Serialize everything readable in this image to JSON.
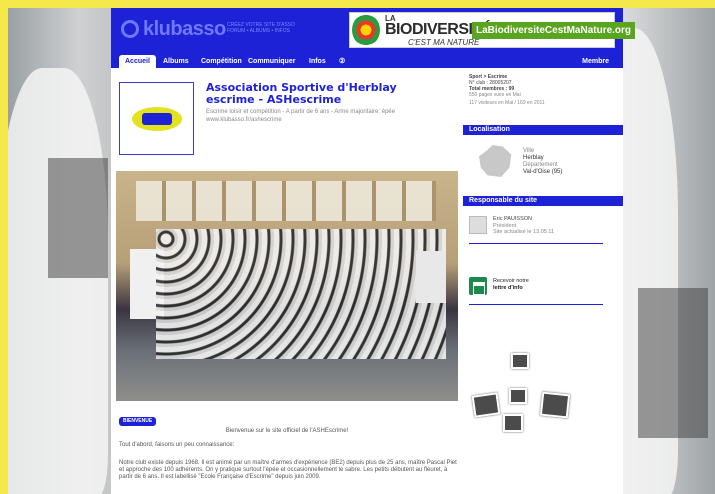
{
  "site": {
    "logo": "klubasso",
    "tagline": "CRÉEZ VOTRE SITE D'ASSO\nFORUM • ALBUMS • INFOS",
    "banner": {
      "line1": "LA",
      "line2": "BIODIVERSITÉ",
      "line3": "C'EST MA NATURE",
      "url": "LaBiodiversiteCestMaNature.org"
    }
  },
  "nav": {
    "items": [
      "Accueil",
      "Albums",
      "Compétition",
      "Communiquer",
      "Infos",
      "②"
    ],
    "member": "Membre"
  },
  "club": {
    "title_line1": "Association Sportive d'Herblay",
    "title_line2": "escrime - ASHescrime",
    "desc_line1": "Escrime loisir et compétition - A partir de 6 ans - Arme majoritaire: épée",
    "desc_line2": "www.klubasso.fr/ashescrime"
  },
  "content": {
    "badge": "BIENVENUE",
    "welcome": "Bienvenue sur le site officiel de l'ASHEscrime!",
    "p1": "Tout d'abord, faisons un peu connaissance:",
    "p2": "Notre club existe depuis 1968. Il est animé par un maître d'armes d'expérience (BE2) depuis plus de 25 ans, maître Pascal Piet et approche des 100 adhérents. On y pratique surtout l'épée et occasionnellement le sabre. Les petits débutent au fleuret, à partir de 6 ans. Il est labellisé \"Ecole Française d'Escrime\" depuis juin 2009."
  },
  "sidebar": {
    "sport": "Sport > Escrime",
    "club_no": "N° club : 28005207",
    "members": "Total membres : 99",
    "pages_viewed": "550 pages vues en Mai",
    "visitors": "117 visiteurs en Mai / 169 en 2011",
    "loc_head": "Localisation",
    "loc_ville_label": "Ville",
    "loc_ville": "Herblay",
    "loc_dep_label": "Département",
    "loc_dep": "Val-d'Oise (95)",
    "resp_head": "Responsable du site",
    "resp_name": "Eric PAUISSON",
    "resp_role": "Président",
    "resp_updated": "Site actualisé le 13.05.11",
    "newsletter_1": "Recevoir notre",
    "newsletter_2": "lettre d'info"
  },
  "colors": {
    "brand_blue": "#1e22d6",
    "page_bg": "#f5e84a",
    "banner_green": "#5aa51f"
  }
}
